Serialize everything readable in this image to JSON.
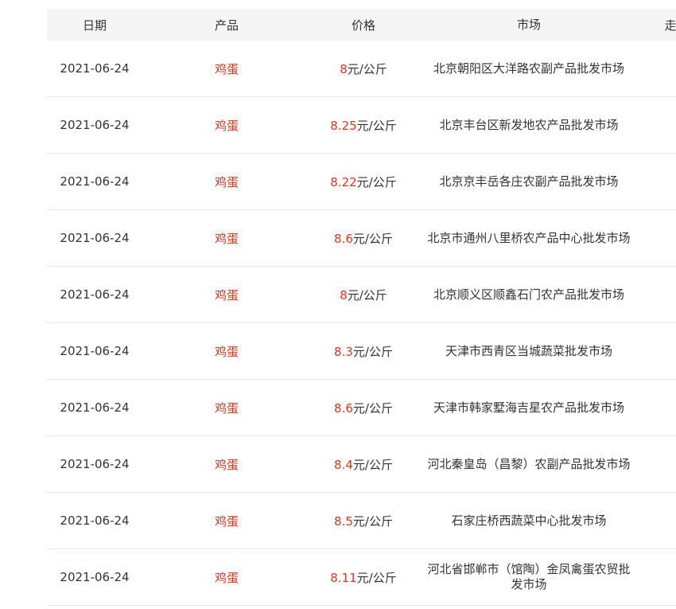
{
  "header": {
    "date": "日期",
    "product": "产品",
    "price": "价格",
    "market": "市场",
    "extra": "走"
  },
  "rows": [
    {
      "date": "2021-06-24",
      "product": "鸡蛋",
      "price": "8",
      "unit": "元/公斤",
      "market": "北京朝阳区大洋路农副产品批发市场"
    },
    {
      "date": "2021-06-24",
      "product": "鸡蛋",
      "price": "8.25",
      "unit": "元/公斤",
      "market": "北京丰台区新发地农产品批发市场"
    },
    {
      "date": "2021-06-24",
      "product": "鸡蛋",
      "price": "8.22",
      "unit": "元/公斤",
      "market": "北京京丰岳各庄农副产品批发市场"
    },
    {
      "date": "2021-06-24",
      "product": "鸡蛋",
      "price": "8.6",
      "unit": "元/公斤",
      "market": "北京市通州八里桥农产品中心批发市场"
    },
    {
      "date": "2021-06-24",
      "product": "鸡蛋",
      "price": "8",
      "unit": "元/公斤",
      "market": "北京顺义区顺鑫石门农产品批发市场"
    },
    {
      "date": "2021-06-24",
      "product": "鸡蛋",
      "price": "8.3",
      "unit": "元/公斤",
      "market": "天津市西青区当城蔬菜批发市场"
    },
    {
      "date": "2021-06-24",
      "product": "鸡蛋",
      "price": "8.6",
      "unit": "元/公斤",
      "market": "天津市韩家墅海吉星农产品批发市场"
    },
    {
      "date": "2021-06-24",
      "product": "鸡蛋",
      "price": "8.4",
      "unit": "元/公斤",
      "market": "河北秦皇岛（昌黎）农副产品批发市场"
    },
    {
      "date": "2021-06-24",
      "product": "鸡蛋",
      "price": "8.5",
      "unit": "元/公斤",
      "market": "石家庄桥西蔬菜中心批发市场"
    },
    {
      "date": "2021-06-24",
      "product": "鸡蛋",
      "price": "8.11",
      "unit": "元/公斤",
      "market": "河北省邯郸市（馆陶）金凤禽蛋农贸批发市场"
    }
  ]
}
